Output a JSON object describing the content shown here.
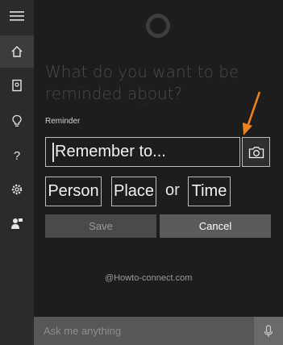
{
  "sidebar": {
    "items": [
      {
        "icon": "hamburger-menu-icon"
      },
      {
        "icon": "home-icon",
        "active": true
      },
      {
        "icon": "notebook-icon"
      },
      {
        "icon": "lightbulb-icon"
      },
      {
        "icon": "help-icon"
      },
      {
        "icon": "settings-icon"
      },
      {
        "icon": "feedback-icon"
      }
    ]
  },
  "cortana": {
    "icon": "cortana-ring-icon"
  },
  "reminder": {
    "question": "What do you want to be reminded about?",
    "ghost_text": "...",
    "label": "Reminder",
    "input_placeholder": "Remember to...",
    "camera_icon": "camera-icon",
    "chips": {
      "person": "Person",
      "place": "Place",
      "or": "or",
      "time": "Time"
    },
    "save_label": "Save",
    "cancel_label": "Cancel"
  },
  "watermark": "@Howto-connect.com",
  "search": {
    "placeholder": "Ask me anything",
    "mic_icon": "microphone-icon"
  },
  "colors": {
    "accent_arrow": "#f0821e",
    "background": "#1d1d1d",
    "sidebar": "#2b2b2b"
  }
}
